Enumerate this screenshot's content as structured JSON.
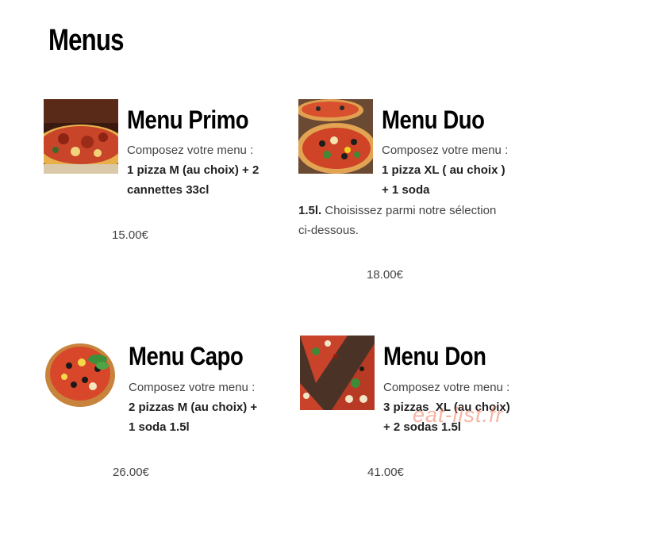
{
  "page": {
    "title": "Menus"
  },
  "menus": [
    {
      "title": "Menu Primo",
      "intro": "Composez votre menu :",
      "line1": "1 pizza M (au choix) + 2",
      "line2": "cannettes 33cl",
      "price": "15.00€"
    },
    {
      "title": "Menu Duo",
      "intro": "Composez votre menu :",
      "line1": "1 pizza XL ( au choix )",
      "line2": "+ 1 soda",
      "line3_bold": "1.5l.",
      "line3_rest": " Choisissez parmi notre sélection",
      "line4": "ci-dessous.",
      "price": "18.00€"
    },
    {
      "title": "Menu Capo",
      "intro": "Composez votre menu :",
      "line1": "2 pizzas M (au choix) +",
      "line2": "1 soda 1.5l",
      "price": "26.00€"
    },
    {
      "title": "Menu Don",
      "intro": "Composez votre menu :",
      "line1": "3 pizzas  XL (au choix)",
      "line2": "+ 2 sodas 1.5l",
      "price": "41.00€"
    }
  ],
  "watermark": "eat-list.fr"
}
